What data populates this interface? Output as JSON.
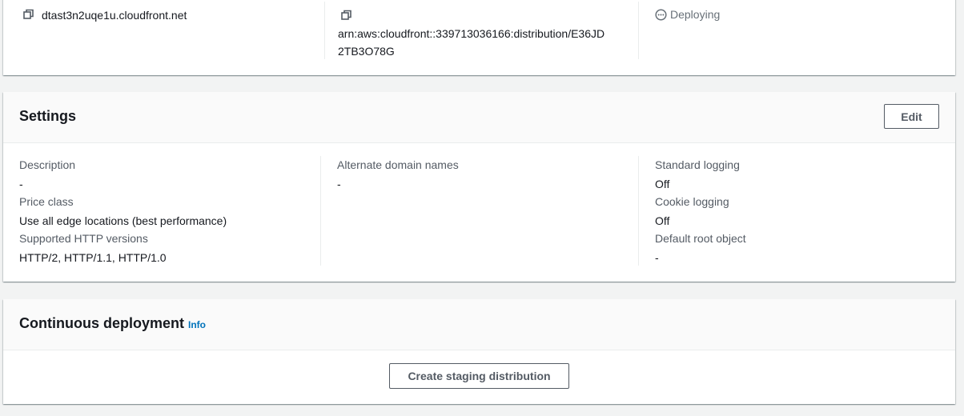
{
  "details": {
    "domain_name": "dtast3n2uqe1u.cloudfront.net",
    "arn_line1": "arn:aws:cloudfront::339713036166:distribution/E36JD",
    "arn_line2": "2TB3O78G",
    "status": "Deploying",
    "icons": {
      "domain_copy": "copy-icon",
      "arn_copy": "copy-icon",
      "status": "ellipsis-circle-icon"
    }
  },
  "settings": {
    "title": "Settings",
    "edit_label": "Edit",
    "col1": [
      {
        "label": "Description",
        "value": "-"
      },
      {
        "label": "Price class",
        "value": "Use all edge locations (best performance)"
      },
      {
        "label": "Supported HTTP versions",
        "value": "HTTP/2, HTTP/1.1, HTTP/1.0"
      }
    ],
    "col2": [
      {
        "label": "Alternate domain names",
        "value": "-"
      }
    ],
    "col3": [
      {
        "label": "Standard logging",
        "value": "Off"
      },
      {
        "label": "Cookie logging",
        "value": "Off"
      },
      {
        "label": "Default root object",
        "value": "-"
      }
    ]
  },
  "continuous_deployment": {
    "title": "Continuous deployment",
    "info_label": "Info",
    "button_label": "Create staging distribution"
  },
  "colors": {
    "background": "#f2f3f3",
    "card": "#ffffff",
    "header": "#fafafa",
    "label": "#545b64",
    "text": "#16191f",
    "link": "#0073bb",
    "status": "#687078"
  }
}
